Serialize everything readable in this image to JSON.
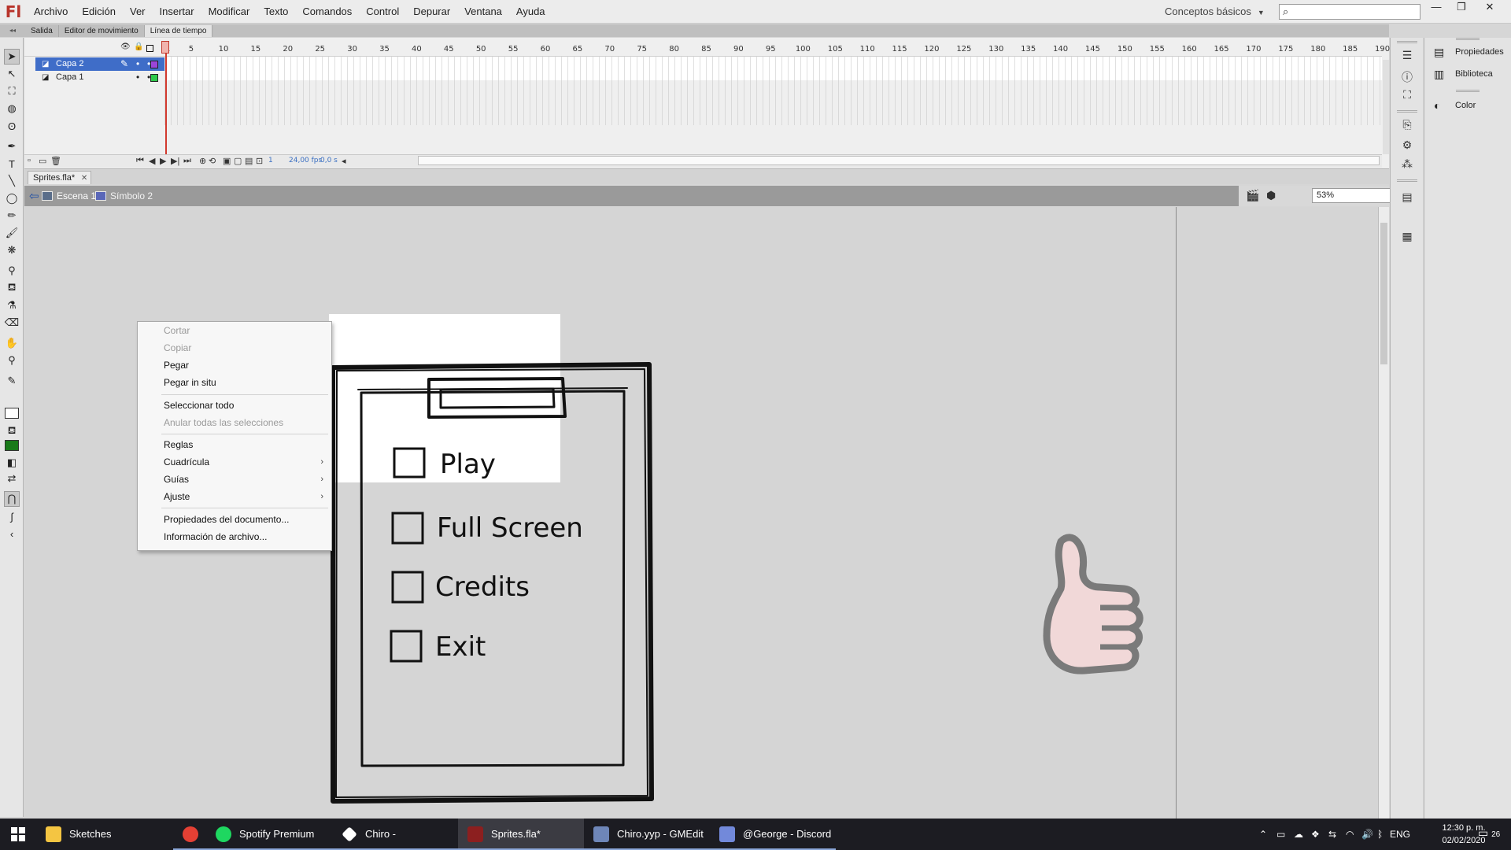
{
  "app": {
    "logo": "Fl",
    "menu": [
      "Archivo",
      "Edición",
      "Ver",
      "Insertar",
      "Modificar",
      "Texto",
      "Comandos",
      "Control",
      "Depurar",
      "Ventana",
      "Ayuda"
    ],
    "workspace": "Conceptos básicos",
    "window_controls": [
      "—",
      "❐",
      "✕"
    ]
  },
  "panel_tabs": [
    "Salida",
    "Editor de movimiento",
    "Línea de tiempo"
  ],
  "timeline": {
    "ruler": [
      "1",
      "5",
      "10",
      "15",
      "20",
      "25",
      "30",
      "35",
      "40",
      "45",
      "50",
      "55",
      "60",
      "65",
      "70",
      "75",
      "80",
      "85",
      "90",
      "95",
      "100",
      "105",
      "110",
      "115",
      "120",
      "125",
      "130",
      "135",
      "140",
      "145",
      "150",
      "155",
      "160",
      "165",
      "170",
      "175",
      "180",
      "185",
      "190"
    ],
    "layers": [
      {
        "name": "Capa 2",
        "color": "#9b45d9",
        "selected": true
      },
      {
        "name": "Capa 1",
        "color": "#2ec84a",
        "selected": false
      }
    ],
    "current_frame": "1",
    "fps": "24,00 fps",
    "time": "0,0 s"
  },
  "document": {
    "tab": "Sprites.fla*",
    "breadcrumb": [
      "Escena 1",
      "Símbolo 2"
    ],
    "zoom": "53%"
  },
  "sketch": {
    "options": [
      "Play",
      "Full Screen",
      "Credits",
      "Exit"
    ]
  },
  "context_menu": {
    "items": [
      {
        "label": "Cortar",
        "disabled": true
      },
      {
        "label": "Copiar",
        "disabled": true
      },
      {
        "label": "Pegar",
        "disabled": false
      },
      {
        "label": "Pegar in situ",
        "disabled": false
      },
      {
        "label": "Seleccionar todo",
        "disabled": false
      },
      {
        "label": "Anular todas las selecciones",
        "disabled": true
      },
      {
        "label": "Reglas",
        "disabled": false
      },
      {
        "label": "Cuadrícula",
        "disabled": false,
        "submenu": true
      },
      {
        "label": "Guías",
        "disabled": false,
        "submenu": true
      },
      {
        "label": "Ajuste",
        "disabled": false,
        "submenu": true
      },
      {
        "label": "Propiedades del documento...",
        "disabled": false
      },
      {
        "label": "Información de archivo...",
        "disabled": false
      }
    ]
  },
  "right_panel": [
    "Propiedades",
    "Biblioteca",
    "Color"
  ],
  "taskbar": {
    "apps": [
      "Sketches",
      "Spotify Premium",
      "Chiro - GameMake...",
      "Sprites.fla*",
      "Chiro.yyp - GMEdit",
      "@George - Discord"
    ],
    "language": "ENG",
    "time": "12:30 p. m.",
    "date": "02/02/2020",
    "notifications": "26"
  }
}
